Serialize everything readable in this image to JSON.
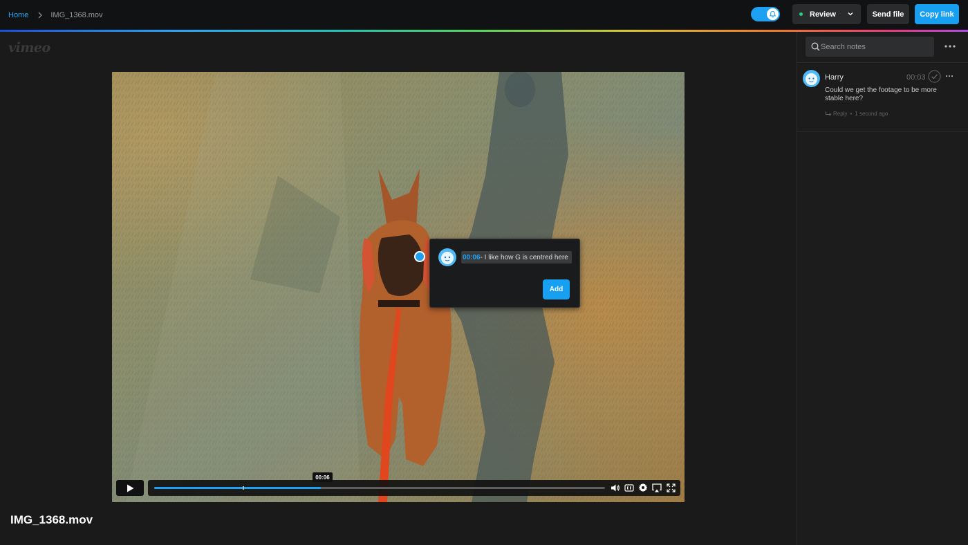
{
  "breadcrumb": {
    "home": "Home",
    "file": "IMG_1368.mov"
  },
  "topbar": {
    "review_label": "Review",
    "send_label": "Send file",
    "copy_label": "Copy link"
  },
  "brand": {
    "logo": "vimeo"
  },
  "player": {
    "title": "IMG_1368.mov",
    "hover_time": "00:06",
    "progress": 0.37
  },
  "annotation": {
    "time": "00:06",
    "text": " - I like how G is centred here",
    "add_label": "Add"
  },
  "sidebar": {
    "search_placeholder": "Search notes",
    "notes": [
      {
        "author": "Harry",
        "time": "00:03",
        "text": "Could we get the footage to be more stable here?",
        "reply_label": "Reply",
        "ago": "1 second ago"
      }
    ]
  },
  "colors": {
    "accent": "#17a0f2",
    "status_dot": "#26d17e"
  }
}
